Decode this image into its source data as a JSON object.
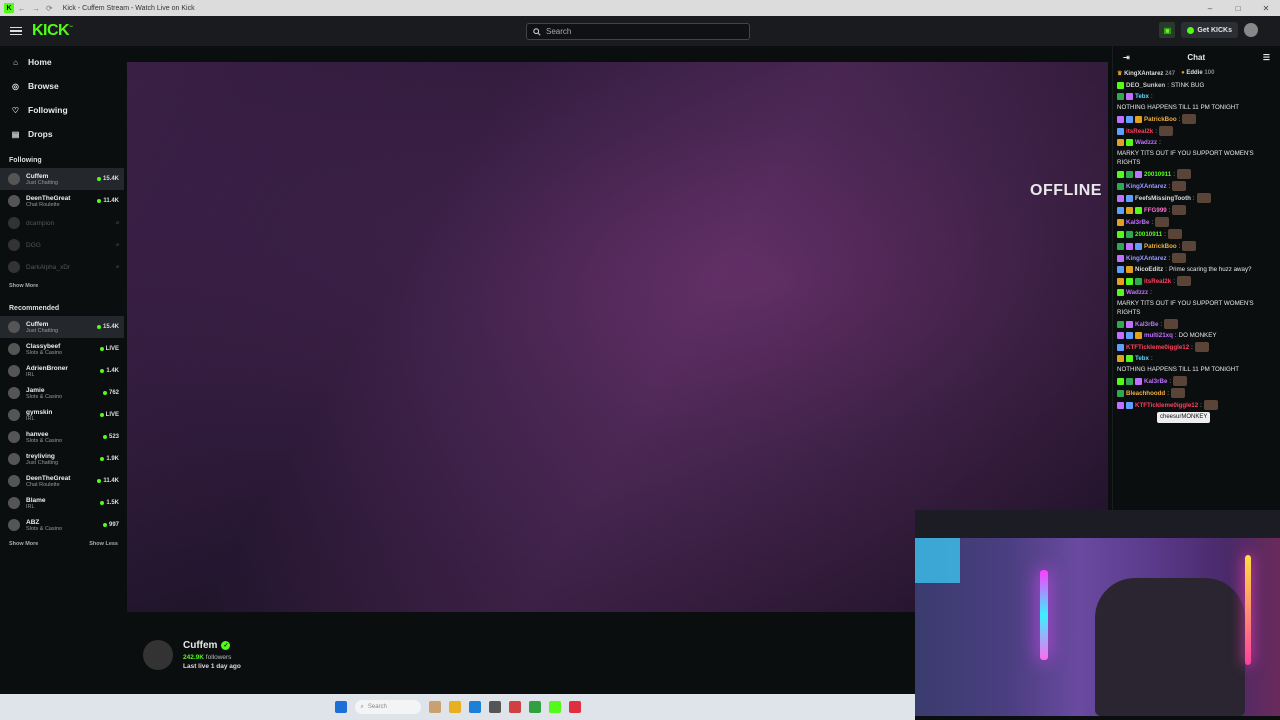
{
  "window": {
    "title": "Kick - Cuffem Stream - Watch Live on Kick"
  },
  "topbar": {
    "logo": "KICK",
    "search_placeholder": "Search",
    "get_kicks": "Get KICKs"
  },
  "nav": [
    {
      "label": "Home",
      "icon": "home-icon"
    },
    {
      "label": "Browse",
      "icon": "compass-icon"
    },
    {
      "label": "Following",
      "icon": "heart-icon"
    },
    {
      "label": "Drops",
      "icon": "gift-icon"
    }
  ],
  "following": {
    "title": "Following",
    "channels": [
      {
        "name": "Cuffem",
        "category": "Just Chatting",
        "viewers": "15.4K"
      },
      {
        "name": "DeenTheGreat",
        "category": "Chat Roulette",
        "viewers": "11.4K"
      },
      {
        "name": "dcampion",
        "category": "",
        "viewers": ""
      },
      {
        "name": "DGG",
        "category": "",
        "viewers": ""
      },
      {
        "name": "DarkAlpha_xDr",
        "category": "",
        "viewers": ""
      }
    ],
    "show_more": "Show More"
  },
  "recommended": {
    "title": "Recommended",
    "channels": [
      {
        "name": "Cuffem",
        "category": "Just Chatting",
        "viewers": "15.4K"
      },
      {
        "name": "Classybeef",
        "category": "Slots & Casino",
        "viewers": "LIVE"
      },
      {
        "name": "AdrienBroner",
        "category": "IRL",
        "viewers": "1.4K"
      },
      {
        "name": "Jamie",
        "category": "Slots & Casino",
        "viewers": "762"
      },
      {
        "name": "gymskin",
        "category": "IRL",
        "viewers": "LIVE"
      },
      {
        "name": "hanvee",
        "category": "Slots & Casino",
        "viewers": "523"
      },
      {
        "name": "treyliving",
        "category": "Just Chatting",
        "viewers": "1.9K"
      },
      {
        "name": "DeenTheGreat",
        "category": "Chat Roulette",
        "viewers": "11.4K"
      },
      {
        "name": "Blame",
        "category": "IRL",
        "viewers": "1.5K"
      },
      {
        "name": "ABZ",
        "category": "Slots & Casino",
        "viewers": "997"
      }
    ],
    "show_more": "Show More",
    "show_less": "Show Less"
  },
  "player": {
    "status": "OFFLINE"
  },
  "streamer": {
    "name": "Cuffem",
    "followers_count": "242.9K",
    "followers_label": "followers",
    "last_live": "Last live 1 day ago"
  },
  "chat": {
    "title": "Chat",
    "pinned": [
      {
        "name": "KingXAntarez",
        "count": "247"
      },
      {
        "name": "Eddie",
        "count": "100"
      }
    ],
    "messages": [
      {
        "user": "DEO_Sunken",
        "color": "#cccccc",
        "text": "STINK BUG"
      },
      {
        "user": "Tebx",
        "color": "#5fd4ff",
        "text": "NOTHING HAPPENS TILL 11 PM TONIGHT"
      },
      {
        "user": "PatrickBoo",
        "color": "#f0b040",
        "text": ""
      },
      {
        "user": "itsReal2k",
        "color": "#ff4060",
        "text": ""
      },
      {
        "user": "Wadzzz",
        "color": "#c070ff",
        "text": "MARKY TITS OUT IF YOU SUPPORT WOMEN'S RIGHTS"
      },
      {
        "user": "20010911",
        "color": "#53fc18",
        "text": ""
      },
      {
        "user": "KingXAntarez",
        "color": "#9a9aff",
        "text": ""
      },
      {
        "user": "FeefsMissingTooth",
        "color": "#dddddd",
        "text": ""
      },
      {
        "user": "FFG999",
        "color": "#ff70d0",
        "text": ""
      },
      {
        "user": "Kal3rBe",
        "color": "#c070ff",
        "text": ""
      },
      {
        "user": "20010911",
        "color": "#53fc18",
        "text": ""
      },
      {
        "user": "PatrickBoo",
        "color": "#f0b040",
        "text": ""
      },
      {
        "user": "KingXAntarez",
        "color": "#9a9aff",
        "text": ""
      },
      {
        "user": "NicoEditz",
        "color": "#dddddd",
        "text": "Prime scaring the huzz away?"
      },
      {
        "user": "itsReal2k",
        "color": "#ff4060",
        "text": ""
      },
      {
        "user": "Wadzzz",
        "color": "#c070ff",
        "text": "MARKY TITS OUT IF YOU SUPPORT WOMEN'S RIGHTS"
      },
      {
        "user": "Kal3rBe",
        "color": "#c070ff",
        "text": ""
      },
      {
        "user": "multi21xq",
        "color": "#c070ff",
        "text": "DO MONKEY"
      },
      {
        "user": "KTFTickleme0iggle12",
        "color": "#ff4060",
        "text": ""
      },
      {
        "user": "Tebx",
        "color": "#5fd4ff",
        "text": "NOTHING HAPPENS TILL 11 PM TONIGHT"
      },
      {
        "user": "Kal3rBe",
        "color": "#c070ff",
        "text": ""
      },
      {
        "user": "Bleachhoodd",
        "color": "#f0b040",
        "text": ""
      },
      {
        "user": "KTFTickleme0iggle12",
        "color": "#ff4060",
        "text": ""
      }
    ],
    "tooltip": "cheesurMONKEY"
  },
  "taskbar": {
    "search_placeholder": "Search"
  },
  "colors": {
    "accent": "#53fc18",
    "background": "#0b0e0f"
  }
}
